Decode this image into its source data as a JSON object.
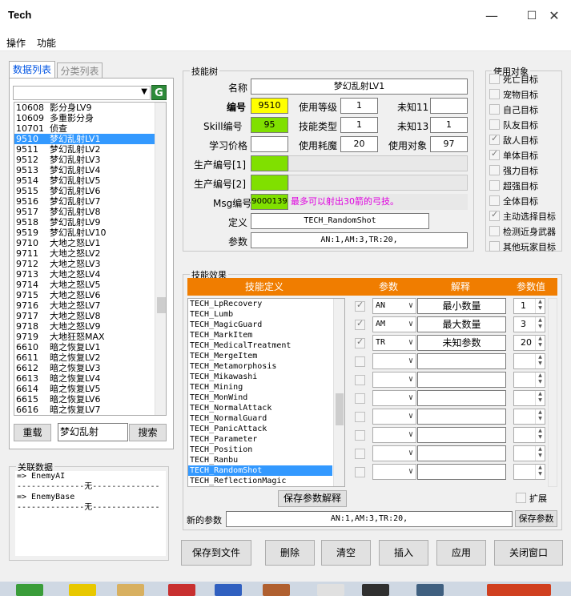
{
  "window": {
    "title": "Tech",
    "minimize": "—",
    "maximize": "☐",
    "close": "✕"
  },
  "menu": [
    "操作",
    "功能"
  ],
  "left_panel": {
    "tabs": [
      "数据列表",
      "分类列表"
    ],
    "active_tab": 0,
    "filter_value": "",
    "rows": [
      {
        "id": "10608",
        "name": "影分身LV9"
      },
      {
        "id": "10609",
        "name": "多重影分身"
      },
      {
        "id": "10701",
        "name": "侦查"
      },
      {
        "id": "9510",
        "name": "梦幻乱射LV1",
        "selected": true
      },
      {
        "id": "9511",
        "name": "梦幻乱射LV2"
      },
      {
        "id": "9512",
        "name": "梦幻乱射LV3"
      },
      {
        "id": "9513",
        "name": "梦幻乱射LV4"
      },
      {
        "id": "9514",
        "name": "梦幻乱射LV5"
      },
      {
        "id": "9515",
        "name": "梦幻乱射LV6"
      },
      {
        "id": "9516",
        "name": "梦幻乱射LV7"
      },
      {
        "id": "9517",
        "name": "梦幻乱射LV8"
      },
      {
        "id": "9518",
        "name": "梦幻乱射LV9"
      },
      {
        "id": "9519",
        "name": "梦幻乱射LV10"
      },
      {
        "id": "9710",
        "name": "大地之怒LV1"
      },
      {
        "id": "9711",
        "name": "大地之怒LV2"
      },
      {
        "id": "9712",
        "name": "大地之怒LV3"
      },
      {
        "id": "9713",
        "name": "大地之怒LV4"
      },
      {
        "id": "9714",
        "name": "大地之怒LV5"
      },
      {
        "id": "9715",
        "name": "大地之怒LV6"
      },
      {
        "id": "9716",
        "name": "大地之怒LV7"
      },
      {
        "id": "9717",
        "name": "大地之怒LV8"
      },
      {
        "id": "9718",
        "name": "大地之怒LV9"
      },
      {
        "id": "9719",
        "name": "大地狂怒MAX"
      },
      {
        "id": "6610",
        "name": "暗之恢复LV1"
      },
      {
        "id": "6611",
        "name": "暗之恢复LV2"
      },
      {
        "id": "6612",
        "name": "暗之恢复LV3"
      },
      {
        "id": "6613",
        "name": "暗之恢复LV4"
      },
      {
        "id": "6614",
        "name": "暗之恢复LV5"
      },
      {
        "id": "6615",
        "name": "暗之恢复LV6"
      },
      {
        "id": "6616",
        "name": "暗之恢复LV7"
      }
    ],
    "reload_label": "重载",
    "search_value": "梦幻乱射",
    "search_label": "搜索"
  },
  "related": {
    "title": "关联数据",
    "lines": [
      "=> EnemyAI",
      "--------------无--------------",
      "=> EnemyBase",
      "--------------无--------------"
    ]
  },
  "skill_tree": {
    "title": "技能树",
    "name_label": "名称",
    "name_value": "梦幻乱射LV1",
    "id_label": "编号",
    "id_value": "9510",
    "level_label": "使用等级",
    "level_value": "1",
    "unknown11_label": "未知11",
    "unknown11_value": "",
    "skill_id_label": "Skill编号",
    "skill_id_value": "95",
    "skill_type_label": "技能类型",
    "skill_type_value": "1",
    "unknown13_label": "未知13",
    "unknown13_value": "1",
    "price_label": "学习价格",
    "price_value": "",
    "mp_label": "使用耗魔",
    "mp_value": "20",
    "target_label": "使用对象",
    "target_value": "97",
    "prod1_label": "生产编号[1]",
    "prod2_label": "生产编号[2]",
    "msg_label": "Msg编号",
    "msg_value": "9000139",
    "msg_text": "最多可以射出30箭的弓技。",
    "def_label": "定义",
    "def_value": "TECH_RandomShot",
    "param_label": "参数",
    "param_value": "AN:1,AM:3,TR:20,"
  },
  "targets": {
    "title": "使用对象",
    "items": [
      {
        "label": "死亡目标",
        "checked": false
      },
      {
        "label": "宠物目标",
        "checked": false
      },
      {
        "label": "自己目标",
        "checked": false
      },
      {
        "label": "队友目标",
        "checked": false
      },
      {
        "label": "敌人目标",
        "checked": true
      },
      {
        "label": "单体目标",
        "checked": true
      },
      {
        "label": "强力目标",
        "checked": false
      },
      {
        "label": "超强目标",
        "checked": false
      },
      {
        "label": "全体目标",
        "checked": false
      },
      {
        "label": "主动选择目标",
        "checked": true
      },
      {
        "label": "检测近身武器",
        "checked": false
      },
      {
        "label": "其他玩家目标",
        "checked": false
      }
    ]
  },
  "effects": {
    "title": "技能效果",
    "headers": [
      "技能定义",
      "参数",
      "解释",
      "参数值"
    ],
    "tech_list": [
      "TECH_LpRecovery",
      "TECH_Lumb",
      "TECH_MagicGuard",
      "TECH_MarkItem",
      "TECH_MedicalTreatment",
      "TECH_MergeItem",
      "TECH_Metamorphosis",
      "TECH_Mikawashi",
      "TECH_Mining",
      "TECH_MonWind",
      "TECH_NormalAttack",
      "TECH_NormalGuard",
      "TECH_PanicAttack",
      "TECH_Parameter",
      "TECH_Position",
      "TECH_Ranbu",
      "TECH_RandomShot",
      "TECH_ReflectionMagic"
    ],
    "tech_selected": 16,
    "params": [
      {
        "checked": true,
        "code": "AN",
        "desc": "最小数量",
        "value": "1"
      },
      {
        "checked": true,
        "code": "AM",
        "desc": "最大数量",
        "value": "3"
      },
      {
        "checked": true,
        "code": "TR",
        "desc": "未知参数",
        "value": "20"
      },
      {
        "checked": false,
        "code": "",
        "desc": "",
        "value": ""
      },
      {
        "checked": false,
        "code": "",
        "desc": "",
        "value": ""
      },
      {
        "checked": false,
        "code": "",
        "desc": "",
        "value": ""
      },
      {
        "checked": false,
        "code": "",
        "desc": "",
        "value": ""
      },
      {
        "checked": false,
        "code": "",
        "desc": "",
        "value": ""
      },
      {
        "checked": false,
        "code": "",
        "desc": "",
        "value": ""
      },
      {
        "checked": false,
        "code": "",
        "desc": "",
        "value": ""
      }
    ],
    "save_explain_label": "保存参数解释",
    "expand_label": "扩展",
    "new_param_label": "新的参数",
    "new_param_value": "AN:1,AM:3,TR:20,",
    "save_param_label": "保存参数"
  },
  "bottom_buttons": [
    "保存到文件",
    "删除",
    "清空",
    "插入",
    "应用",
    "关闭窗口"
  ],
  "colors": {
    "accent_orange": "#f07d00",
    "id_yellow": "#ffff00",
    "skill_green": "#80e000",
    "selection_blue": "#3399ff",
    "msg_magenta": "#e000e0"
  }
}
